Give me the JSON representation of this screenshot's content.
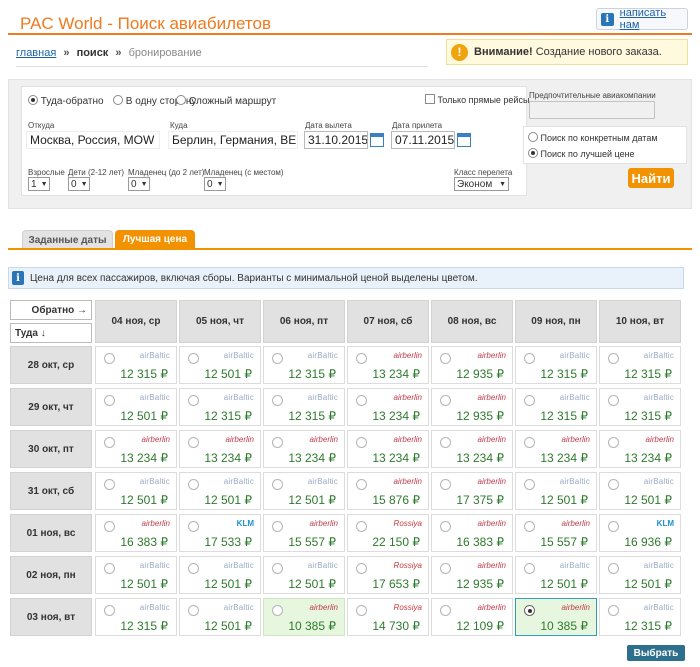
{
  "header": {
    "title": "PAC World - Поиск авиабилетов",
    "write_us": "написать нам"
  },
  "breadcrumb": {
    "home": "главная",
    "sep": "»",
    "search": "поиск",
    "booking": "бронирование"
  },
  "notice": {
    "bold": "Внимание!",
    "text": " Создание нового заказа."
  },
  "search_form": {
    "trip_types": [
      "Туда-обратно",
      "В одну сторону",
      "Сложный маршрут"
    ],
    "selected_trip_type": "Туда-обратно",
    "direct_only_label": "Только прямые рейсы",
    "from_label": "Откуда",
    "from_value": "Москва, Россия, MOW",
    "to_label": "Куда",
    "to_value": "Берлин, Германия, BER",
    "depart_label": "Дата вылета",
    "depart_value": "31.10.2015",
    "return_label": "Дата прилета",
    "return_value": "07.11.2015",
    "adults_label": "Взрослые",
    "adults_value": "1",
    "children_label": "Дети (2-12 лет)",
    "children_value": "0",
    "infants_label": "Младенец (до 2 лет)",
    "infants_value": "0",
    "infants_seat_label": "Младенец (с местом)",
    "infants_seat_value": "0",
    "class_label": "Класс перелета",
    "class_value": "Эконом",
    "airlines_label": "Предпочтительные авиакомпании",
    "mode_options": [
      "Поиск по конкретным датам",
      "Поиск по лучшей цене"
    ],
    "selected_mode": "Поиск по лучшей цене",
    "find_button": "Найти"
  },
  "tabs": [
    {
      "label": "Заданные даты",
      "active": false
    },
    {
      "label": "Лучшая цена",
      "active": true
    }
  ],
  "info_text": "Цена для всех пассажиров, включая сборы. Варианты с минимальной ценой выделены цветом.",
  "grid": {
    "back_label": "Обратно →",
    "there_label": "Туда ↓",
    "columns": [
      "04 ноя, ср",
      "05 ноя, чт",
      "06 ноя, пт",
      "07 ноя, сб",
      "08 ноя, вс",
      "09 ноя, пн",
      "10 ноя, вт"
    ],
    "rows": [
      {
        "label": "28 окт, ср",
        "cells": [
          {
            "airline": "airBaltic",
            "price": "12 315 ₽"
          },
          {
            "airline": "airBaltic",
            "price": "12 501 ₽"
          },
          {
            "airline": "airBaltic",
            "price": "12 315 ₽"
          },
          {
            "airline": "airberlin",
            "price": "13 234 ₽"
          },
          {
            "airline": "airberlin",
            "price": "12 935 ₽"
          },
          {
            "airline": "airBaltic",
            "price": "12 315 ₽"
          },
          {
            "airline": "airBaltic",
            "price": "12 315 ₽"
          }
        ]
      },
      {
        "label": "29 окт, чт",
        "cells": [
          {
            "airline": "airBaltic",
            "price": "12 501 ₽"
          },
          {
            "airline": "airBaltic",
            "price": "12 315 ₽"
          },
          {
            "airline": "airBaltic",
            "price": "12 315 ₽"
          },
          {
            "airline": "airberlin",
            "price": "13 234 ₽"
          },
          {
            "airline": "airberlin",
            "price": "12 935 ₽"
          },
          {
            "airline": "airBaltic",
            "price": "12 315 ₽"
          },
          {
            "airline": "airBaltic",
            "price": "12 315 ₽"
          }
        ]
      },
      {
        "label": "30 окт, пт",
        "cells": [
          {
            "airline": "airberlin",
            "price": "13 234 ₽"
          },
          {
            "airline": "airberlin",
            "price": "13 234 ₽"
          },
          {
            "airline": "airberlin",
            "price": "13 234 ₽"
          },
          {
            "airline": "airberlin",
            "price": "13 234 ₽"
          },
          {
            "airline": "airberlin",
            "price": "13 234 ₽"
          },
          {
            "airline": "airberlin",
            "price": "13 234 ₽"
          },
          {
            "airline": "airberlin",
            "price": "13 234 ₽"
          }
        ]
      },
      {
        "label": "31 окт, сб",
        "cells": [
          {
            "airline": "airBaltic",
            "price": "12 501 ₽"
          },
          {
            "airline": "airBaltic",
            "price": "12 501 ₽"
          },
          {
            "airline": "airBaltic",
            "price": "12 501 ₽"
          },
          {
            "airline": "airberlin",
            "price": "15 876 ₽"
          },
          {
            "airline": "airberlin",
            "price": "17 375 ₽"
          },
          {
            "airline": "airBaltic",
            "price": "12 501 ₽"
          },
          {
            "airline": "airBaltic",
            "price": "12 501 ₽"
          }
        ]
      },
      {
        "label": "01 ноя, вс",
        "cells": [
          {
            "airline": "airberlin",
            "price": "16 383 ₽"
          },
          {
            "airline": "KLM",
            "price": "17 533 ₽"
          },
          {
            "airline": "airberlin",
            "price": "15 557 ₽"
          },
          {
            "airline": "Rossiya",
            "price": "22 150 ₽"
          },
          {
            "airline": "airberlin",
            "price": "16 383 ₽"
          },
          {
            "airline": "airberlin",
            "price": "15 557 ₽"
          },
          {
            "airline": "KLM",
            "price": "16 936 ₽"
          }
        ]
      },
      {
        "label": "02 ноя, пн",
        "cells": [
          {
            "airline": "airBaltic",
            "price": "12 501 ₽"
          },
          {
            "airline": "airBaltic",
            "price": "12 501 ₽"
          },
          {
            "airline": "airBaltic",
            "price": "12 501 ₽"
          },
          {
            "airline": "Rossiya",
            "price": "17 653 ₽"
          },
          {
            "airline": "airberlin",
            "price": "12 935 ₽"
          },
          {
            "airline": "airBaltic",
            "price": "12 501 ₽"
          },
          {
            "airline": "airBaltic",
            "price": "12 501 ₽"
          }
        ]
      },
      {
        "label": "03 ноя, вт",
        "cells": [
          {
            "airline": "airBaltic",
            "price": "12 315 ₽"
          },
          {
            "airline": "airBaltic",
            "price": "12 501 ₽"
          },
          {
            "airline": "airberlin",
            "price": "10 385 ₽",
            "highlight": true
          },
          {
            "airline": "Rossiya",
            "price": "14 730 ₽"
          },
          {
            "airline": "airberlin",
            "price": "12 109 ₽"
          },
          {
            "airline": "airberlin",
            "price": "10 385 ₽",
            "highlight": true,
            "selected": true
          },
          {
            "airline": "airBaltic",
            "price": "12 315 ₽"
          }
        ]
      }
    ]
  },
  "choose_button": "Выбрать",
  "colors": {
    "accent": "#f39200",
    "title": "#ee7b1f",
    "price": "#2e7a2e",
    "highlight": "#e7f7df",
    "button_dark": "#2e6f8e"
  }
}
